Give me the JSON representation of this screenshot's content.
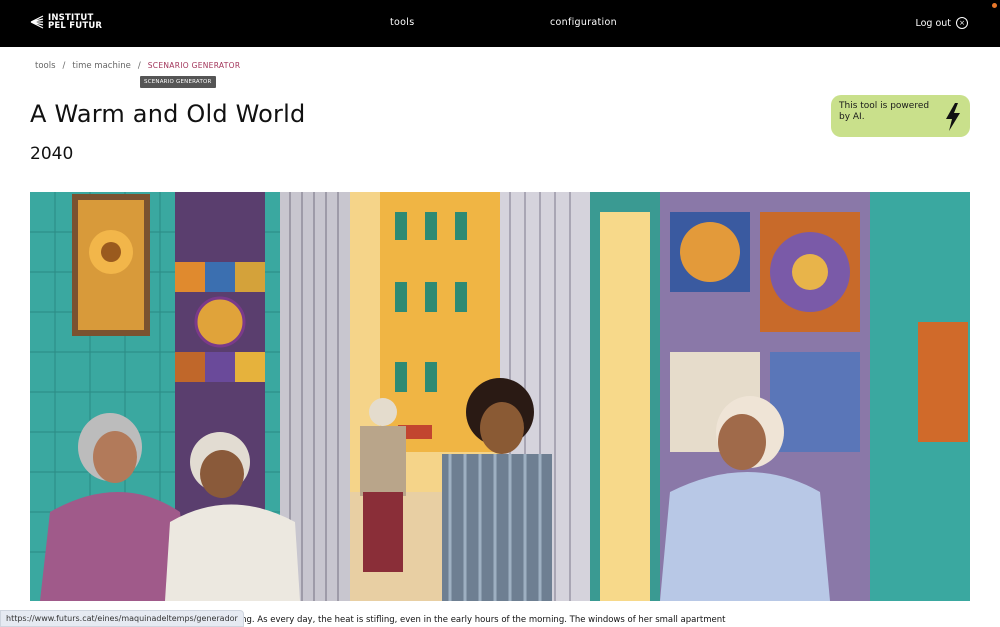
{
  "header": {
    "logo_line1": "INSTITUT",
    "logo_line2": "PEL FUTUR",
    "nav_tools": "tools",
    "nav_config": "configuration",
    "logout": "Log out"
  },
  "breadcrumb": {
    "items": [
      "tools",
      "time machine"
    ],
    "current": "SCENARIO GENERATOR",
    "separator": "/"
  },
  "tooltip": "SCENARIO GENERATOR",
  "page": {
    "title": "A Warm and Old World",
    "year": "2040"
  },
  "ai_badge": {
    "text": "This tool is powered by AI.",
    "color": "#c9e08b"
  },
  "image": {
    "icon": "illustration-street-scene"
  },
  "story_excerpt": "rning. As every day, the heat is stifling, even in the early hours of the morning. The windows of her small apartment",
  "status_url": "https://www.futurs.cat/eines/maquinadeltemps/generador",
  "colors": {
    "topbar": "#000000",
    "accent": "#a2345a",
    "badge": "#c9e08b"
  }
}
